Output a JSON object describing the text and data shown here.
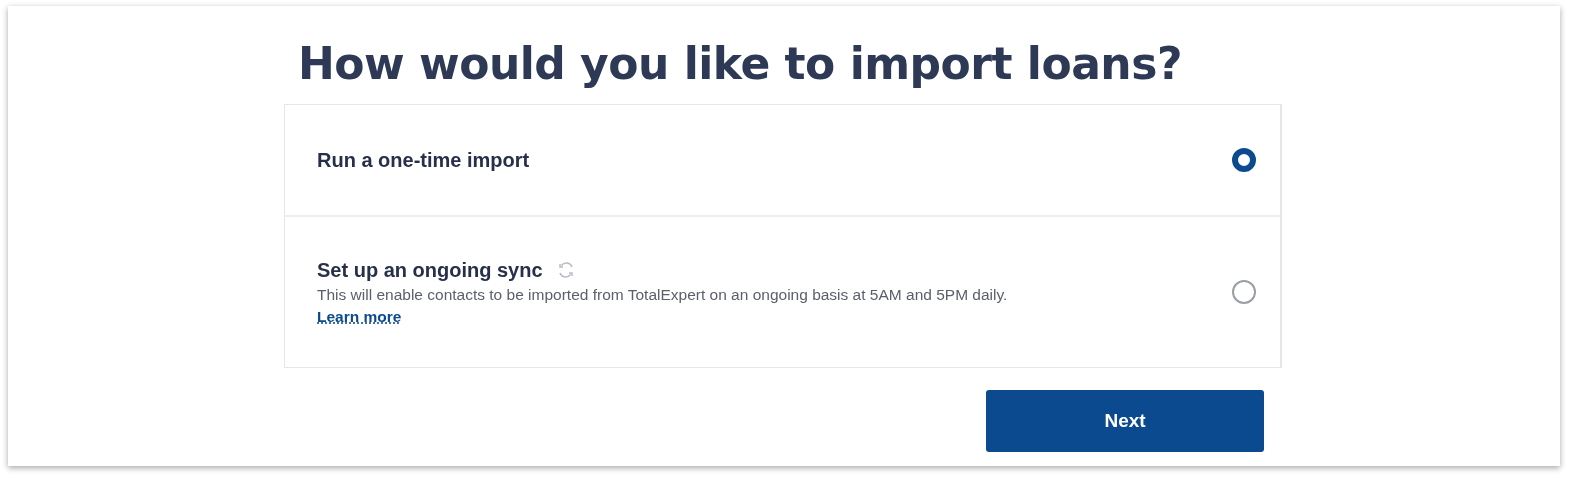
{
  "heading": "How would you like to import loans?",
  "options": [
    {
      "kind": "simple",
      "title": "Run a one-time import",
      "selected": true
    },
    {
      "kind": "sync",
      "title": "Set up an ongoing sync",
      "description": "This will enable contacts to be imported from TotalExpert on an ongoing basis at 5AM and 5PM daily.",
      "link": "Learn more",
      "selected": false
    }
  ],
  "next_button": "Next"
}
